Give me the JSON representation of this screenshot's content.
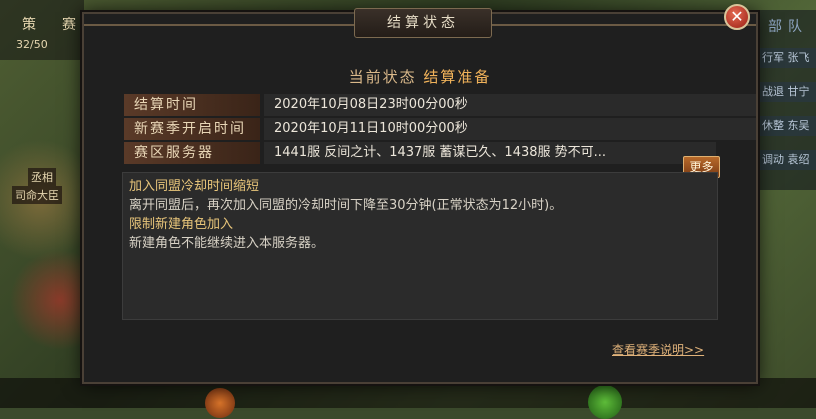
{
  "background": {
    "left_tags": [
      "策",
      "赛"
    ],
    "left_count": "32/50",
    "left_mini": [
      "丞相",
      "司命大臣"
    ],
    "right_header": "部队",
    "right_rows": [
      "行军 张飞",
      "战退 甘宁",
      "休整 东吴",
      "调动 袁绍"
    ]
  },
  "dialog": {
    "title": "结算状态",
    "status_label": "当前状态",
    "status_value": "结算准备",
    "rows": [
      {
        "label": "结算时间",
        "value": "2020年10月08日23时00分00秒"
      },
      {
        "label": "新赛季开启时间",
        "value": "2020年10月11日10时00分00秒"
      },
      {
        "label": "赛区服务器",
        "value": "1441服 反间之计、1437服 蓄谋已久、1438服 势不可..."
      }
    ],
    "more_label": "更多",
    "description": [
      {
        "text": "加入同盟冷却时间缩短",
        "head": true
      },
      {
        "text": "离开同盟后，再次加入同盟的冷却时间下降至30分钟(正常状态为12小时)。",
        "head": false
      },
      {
        "text": "限制新建角色加入",
        "head": true
      },
      {
        "text": "新建角色不能继续进入本服务器。",
        "head": false
      }
    ],
    "rules_link": "查看赛季说明>>"
  }
}
